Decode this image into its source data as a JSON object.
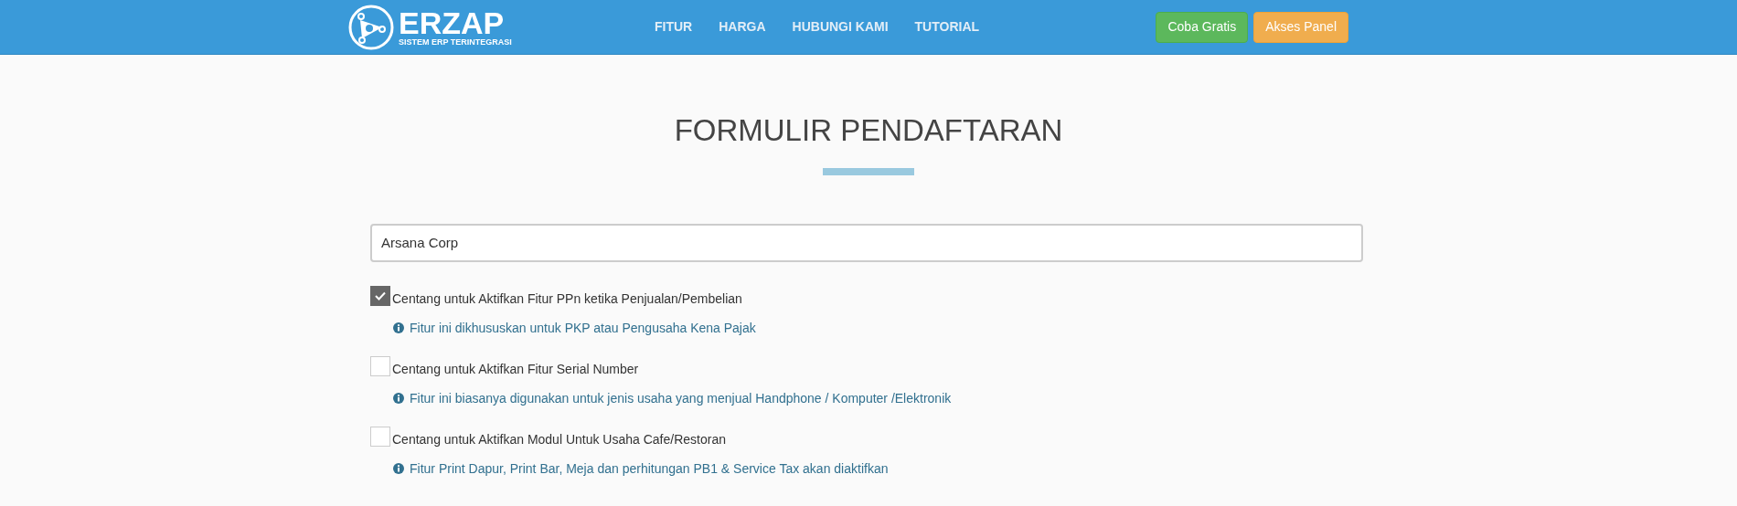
{
  "navbar": {
    "logo": {
      "name": "ERZAP",
      "tagline": "SISTEM ERP TERINTEGRASI"
    },
    "links": [
      "FITUR",
      "HARGA",
      "HUBUNGI KAMI",
      "TUTORIAL"
    ],
    "buttons": [
      {
        "label": "Coba Gratis",
        "kind": "success"
      },
      {
        "label": "Akses Panel",
        "kind": "warning"
      }
    ]
  },
  "form": {
    "title": "FORMULIR PENDAFTARAN",
    "company_field": {
      "value": "Arsana Corp"
    },
    "options": [
      {
        "label": "Centang untuk Aktifkan Fitur PPn ketika Penjualan/Pembelian",
        "checked": true,
        "hint": "Fitur ini dikhususkan untuk PKP atau Pengusaha Kena Pajak"
      },
      {
        "label": "Centang untuk Aktifkan Fitur Serial Number",
        "checked": false,
        "hint": "Fitur ini biasanya digunakan untuk jenis usaha yang menjual Handphone / Komputer /Elektronik"
      },
      {
        "label": "Centang untuk Aktifkan Modul Untuk Usaha Cafe/Restoran",
        "checked": false,
        "hint": "Fitur Print Dapur, Print Bar, Meja dan perhitungan PB1 & Service Tax akan diaktifkan"
      }
    ]
  }
}
